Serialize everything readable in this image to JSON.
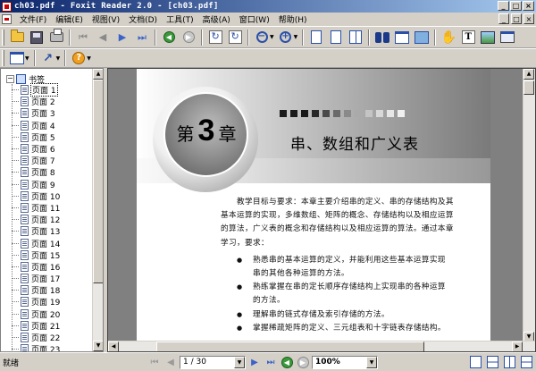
{
  "window": {
    "title": "ch03.pdf - Foxit Reader 2.0 - [ch03.pdf]",
    "minimize": "_",
    "maximize": "□",
    "close": "×"
  },
  "menu": {
    "items": [
      "文件(F)",
      "编辑(E)",
      "视图(V)",
      "文档(D)",
      "工具(T)",
      "高级(A)",
      "窗口(W)",
      "帮助(H)"
    ]
  },
  "bookmarks": {
    "root_label": "书签",
    "expander": "−",
    "selected_index": 0,
    "items": [
      "页面 1",
      "页面 2",
      "页面 3",
      "页面 4",
      "页面 5",
      "页面 6",
      "页面 7",
      "页面 8",
      "页面 9",
      "页面 10",
      "页面 11",
      "页面 12",
      "页面 13",
      "页面 14",
      "页面 15",
      "页面 16",
      "页面 17",
      "页面 18",
      "页面 19",
      "页面 20",
      "页面 21",
      "页面 22",
      "页面 23"
    ]
  },
  "document": {
    "chapter_prefix": "第",
    "chapter_number": "3",
    "chapter_suffix": "章",
    "chapter_title": "串、数组和广义表",
    "header_squares": [
      "#1a1a1a",
      "#1a1a1a",
      "#1a1a1a",
      "#2a2a2a",
      "#4a4a4a",
      "#6a6a6a",
      "#8a8a8a",
      "#aaaaaa",
      "#c4c4c4",
      "#d8d8d8",
      "#e6e6e6",
      "#f0f0f0"
    ],
    "intro_lines": [
      "教学目标与要求：本章主要介绍串的定义、串的存储结构及其",
      "基本运算的实现，多维数组、矩阵的概念、存储结构以及相应运算",
      "的算法，广义表的概念和存储结构以及相应运算的算法。通过本章",
      "学习，要求："
    ],
    "bullets": [
      {
        "line1": "熟悉串的基本运算的定义，并能利用这些基本运算实现",
        "line2": "串的其他各种运算的方法。"
      },
      {
        "line1": "熟练掌握在串的定长顺序存储结构上实现串的各种运算",
        "line2": "的方法。"
      },
      {
        "line1": "理解串的链式存储及索引存储的方法。",
        "line2": ""
      },
      {
        "line1": "掌握稀疏矩阵的定义、三元组表和十字链表存储结构。",
        "line2": ""
      }
    ]
  },
  "statusbar": {
    "text": "就绪",
    "page_value": "1 / 30",
    "zoom_value": "100%"
  }
}
